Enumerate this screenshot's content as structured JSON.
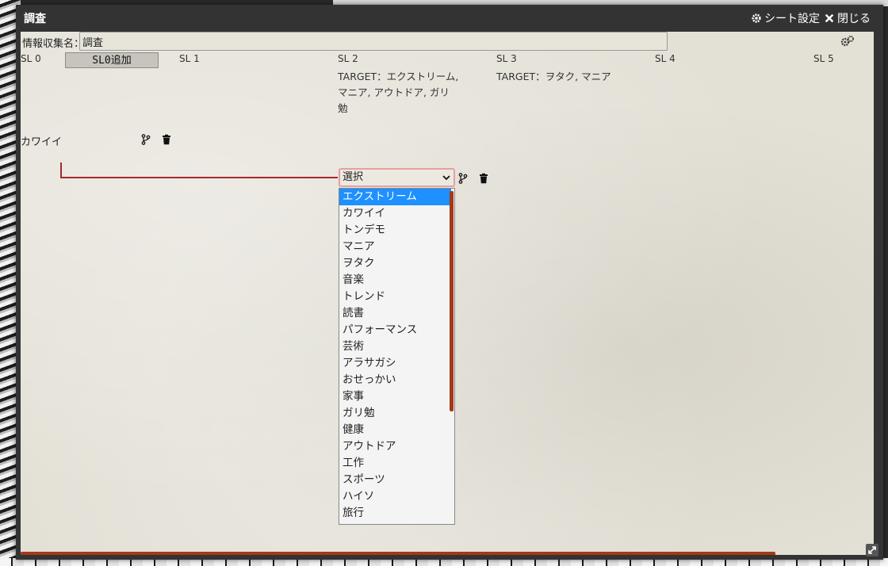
{
  "window": {
    "title": "調査",
    "sheet_settings_label": "シート設定",
    "close_label": "閉じる"
  },
  "form": {
    "name_label": "情報収集名：",
    "name_value": "調査"
  },
  "levels": {
    "sl0": "SL 0",
    "add_sl0_label": "SL0追加",
    "sl1": "SL 1",
    "sl2": "SL 2",
    "sl2_target_line1": "TARGET：エクストリーム,",
    "sl2_target_line2": "マニア, アウトドア, ガリ",
    "sl2_target_line3": "勉",
    "sl3": "SL 3",
    "sl3_target": "TARGET：ヲタク, マニア",
    "sl4": "SL 4",
    "sl5": "SL 5"
  },
  "row": {
    "label": "カワイイ"
  },
  "select": {
    "value": "選択",
    "options": [
      "エクストリーム",
      "カワイイ",
      "トンデモ",
      "マニア",
      "ヲタク",
      "音楽",
      "トレンド",
      "読書",
      "パフォーマンス",
      "芸術",
      "アラサガシ",
      "おせっかい",
      "家事",
      "ガリ勉",
      "健康",
      "アウトドア",
      "工作",
      "スポーツ",
      "ハイソ",
      "旅行"
    ],
    "highlighted_index": 0
  },
  "colors": {
    "accent": "#a52a2a",
    "highlight": "#1e90ff",
    "scrollbar": "#a33a1a",
    "paper": "#e3e0d6"
  }
}
